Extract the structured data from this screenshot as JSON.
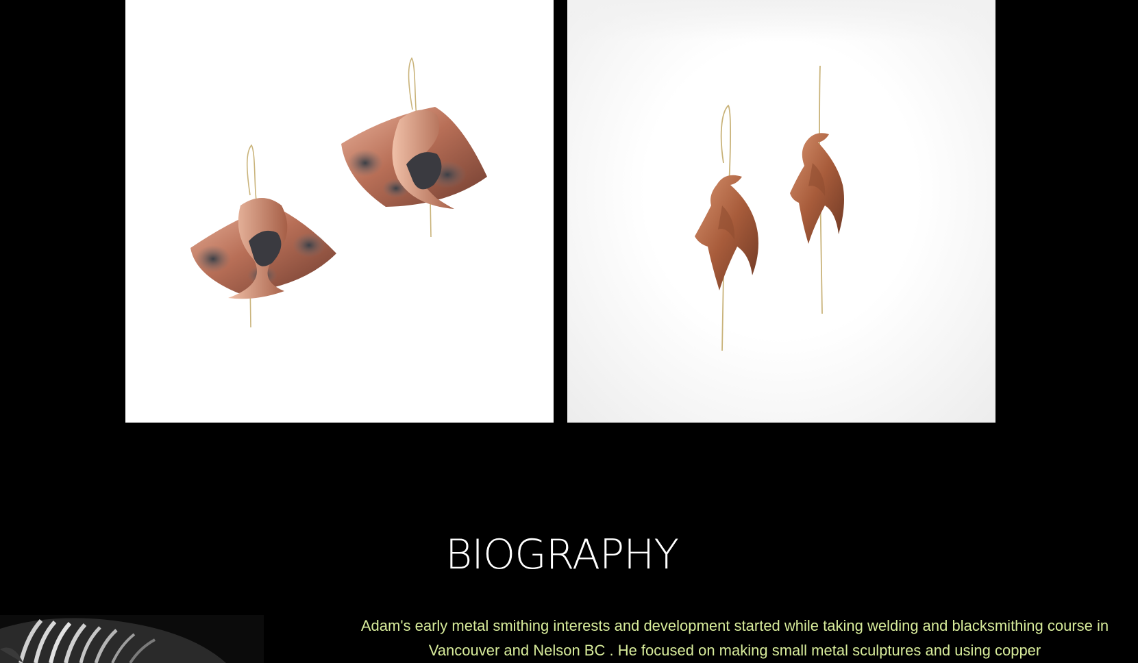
{
  "gallery": {
    "items": [
      {
        "icon": "copper-wave-earrings-photo"
      },
      {
        "icon": "copper-axe-earrings-photo"
      }
    ]
  },
  "biography": {
    "heading": "BIOGRAPHY",
    "text": "Adam's early metal smithing interests and development started while taking welding and blacksmithing course in Vancouver and Nelson BC . He focused on making small metal sculptures and using copper",
    "text_color": "#d8ec9b"
  },
  "portrait": {
    "icon": "artist-portrait-photo"
  }
}
